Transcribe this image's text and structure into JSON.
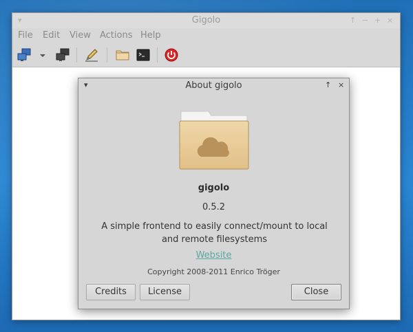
{
  "window": {
    "title": "Gigolo",
    "titlebar_icons": {
      "menu": "▾",
      "up": "↑",
      "minimize": "−",
      "maximize": "+",
      "close": "×"
    }
  },
  "menubar": {
    "items": [
      "File",
      "Edit",
      "View",
      "Actions",
      "Help"
    ]
  },
  "toolbar": {
    "tools": [
      "connect-network-icon",
      "dropdown-arrow-icon",
      "disconnect-network-icon",
      "edit-pencil-icon",
      "open-folder-icon",
      "terminal-icon",
      "quit-power-icon"
    ]
  },
  "dialog": {
    "title": "About gigolo",
    "titlebar_icons": {
      "menu": "▾",
      "up": "↑",
      "close": "×"
    },
    "app_name": "gigolo",
    "version": "0.5.2",
    "description": "A simple frontend to easily connect/mount to local and remote filesystems",
    "website_label": "Website",
    "copyright": "Copyright 2008-2011 Enrico Tröger",
    "buttons": {
      "credits": "Credits",
      "license": "License",
      "close": "Close"
    }
  },
  "colors": {
    "desktop": "#2a86d3",
    "link": "#5aa8a0",
    "folder": "#e8cf9e",
    "power": "#d9282a"
  }
}
